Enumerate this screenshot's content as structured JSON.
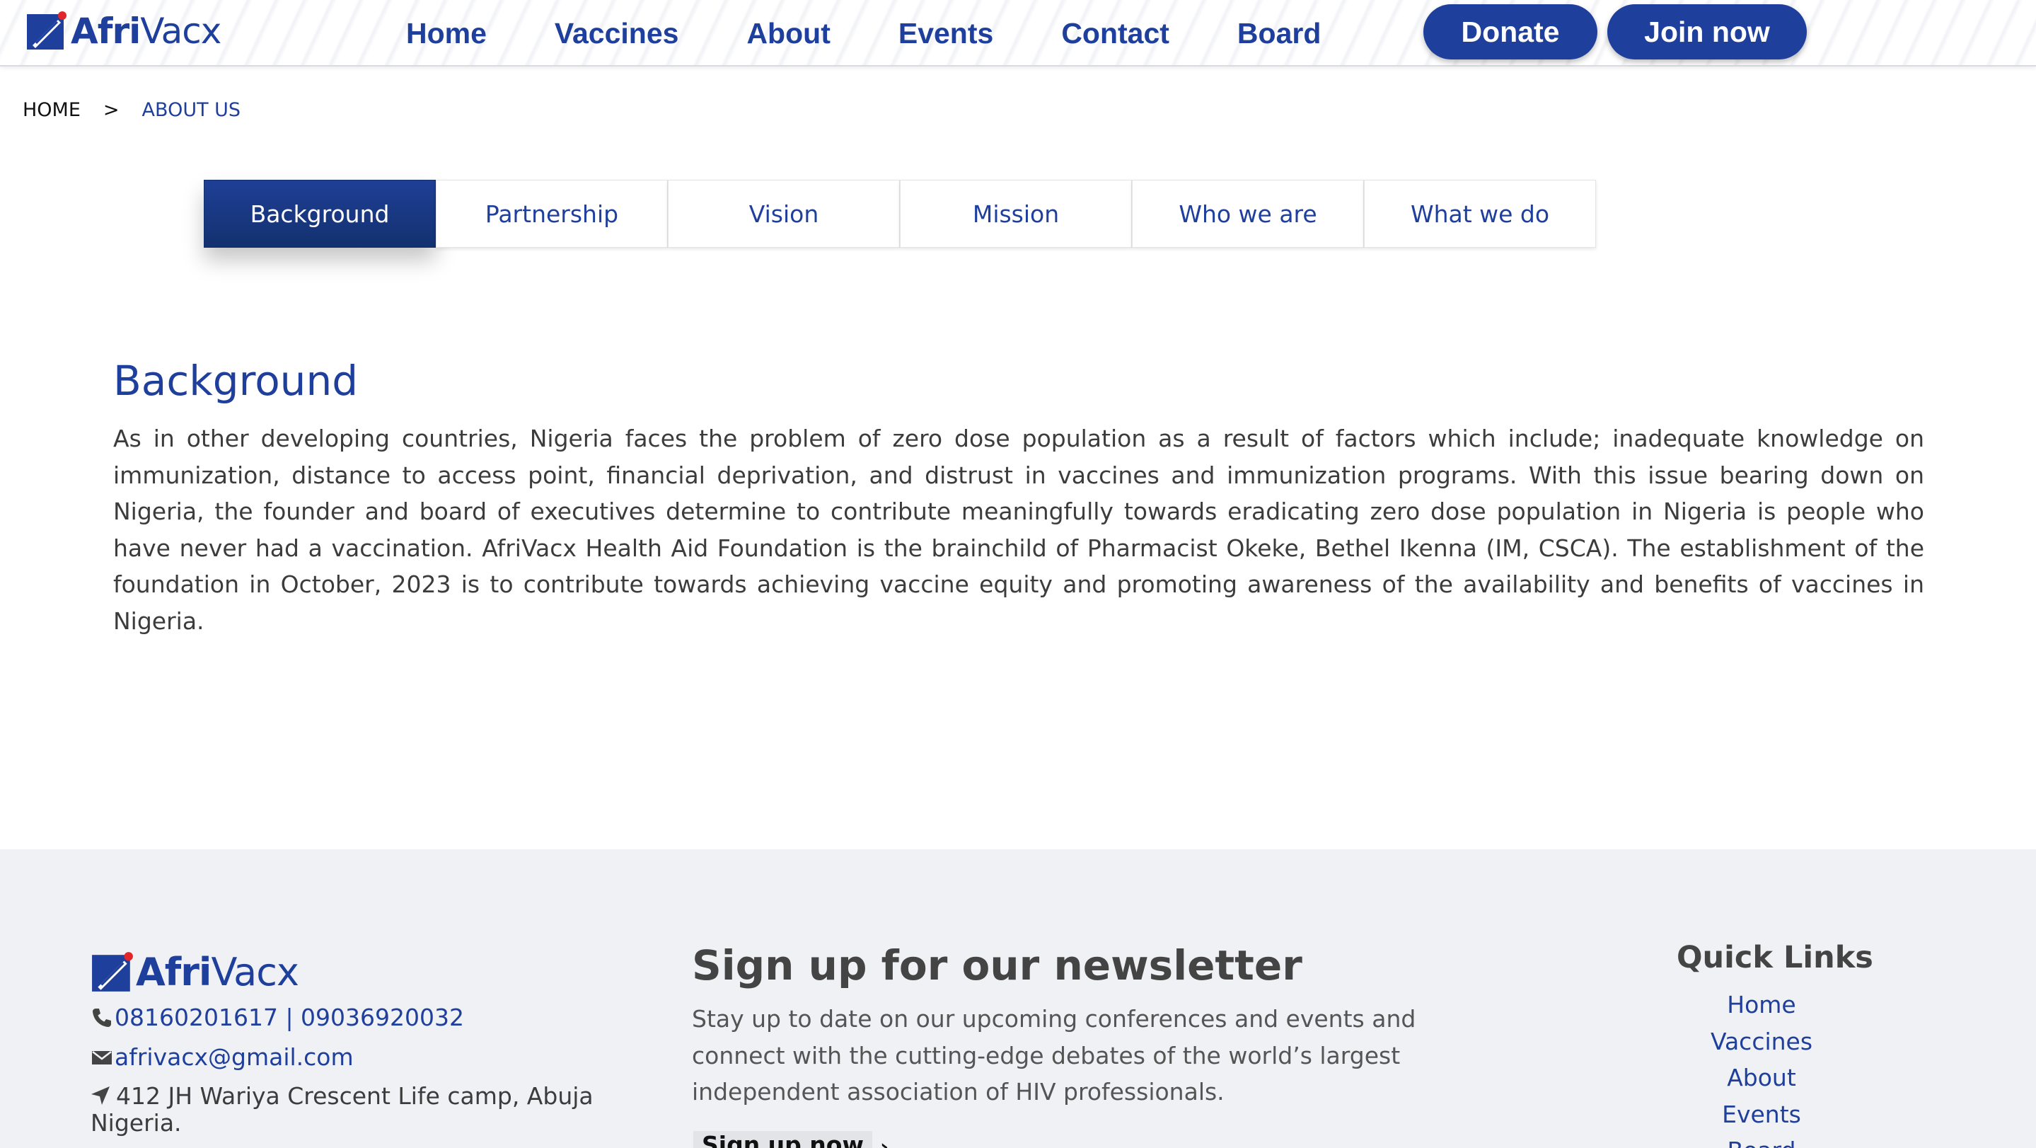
{
  "brand": {
    "name_bold": "Afri",
    "name_light": "Vacx",
    "color": "#1f3f9c",
    "accent": "#e0262b"
  },
  "nav": {
    "items": [
      "Home",
      "Vaccines",
      "About",
      "Events",
      "Contact",
      "Board"
    ],
    "donate_label": "Donate",
    "join_label": "Join now"
  },
  "breadcrumb": {
    "home": "HOME",
    "separator": ">",
    "current": "ABOUT US"
  },
  "tabs": {
    "items": [
      "Background",
      "Partnership",
      "Vision",
      "Mission",
      "Who we are",
      "What we do"
    ],
    "active": "Background"
  },
  "content": {
    "title": "Background",
    "body": "As in other developing countries, Nigeria faces the problem of zero dose population as a result of factors which include; inadequate knowledge on immunization, distance to access point, financial deprivation, and distrust in vaccines and immunization programs. With this issue bearing down on Nigeria, the founder and board of executives determine to contribute meaningfully towards eradicating zero dose population in Nigeria is people who have never had a vaccination. AfriVacx Health Aid Foundation is the brainchild of Pharmacist Okeke, Bethel Ikenna (IM, CSCA). The establishment of the foundation in October, 2023 is to contribute towards achieving vaccine equity and promoting awareness of the availability and benefits of vaccines in Nigeria."
  },
  "footer": {
    "phone": "08160201617 | 09036920032",
    "email": "afrivacx@gmail.com",
    "address": "412 JH Wariya Crescent Life camp, Abuja Nigeria.",
    "newsletter": {
      "title": "Sign up for our newsletter",
      "text": "Stay up to date on our upcoming conferences and events and connect with the cutting-edge debates of the world’s largest independent association of HIV professionals.",
      "signup_label": "Sign up now",
      "arrow": "›"
    },
    "quick_links": {
      "title": "Quick Links",
      "items": [
        "Home",
        "Vaccines",
        "About",
        "Events",
        "Board"
      ]
    }
  }
}
